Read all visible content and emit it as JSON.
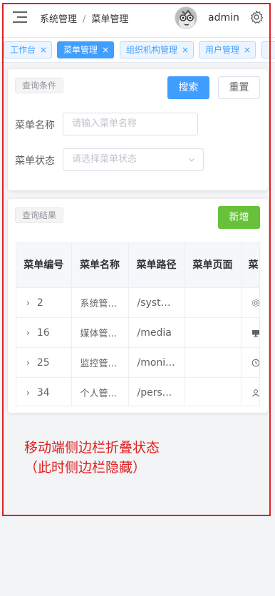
{
  "header": {
    "breadcrumb": [
      "系统管理",
      "菜单管理"
    ],
    "breadcrumb_separator": "/",
    "username": "admin"
  },
  "tags": [
    {
      "label": "工作台",
      "active": false
    },
    {
      "label": "菜单管理",
      "active": true
    },
    {
      "label": "组织机构管理",
      "active": false
    },
    {
      "label": "用户管理",
      "active": false
    }
  ],
  "tag_close": "×",
  "query": {
    "section_label": "查询条件",
    "search_button": "搜索",
    "reset_button": "重置",
    "name_label": "菜单名称",
    "name_placeholder": "请输入菜单名称",
    "status_label": "菜单状态",
    "status_placeholder": "请选择菜单状态"
  },
  "results": {
    "section_label": "查询结果",
    "add_button": "新增",
    "columns": [
      "菜单编号",
      "菜单名称",
      "菜单路径",
      "菜单页面",
      "菜"
    ],
    "rows": [
      {
        "id": "2",
        "name": "系统管...",
        "path": "/system",
        "page": "",
        "icon": "gear-icon"
      },
      {
        "id": "16",
        "name": "媒体管...",
        "path": "/media",
        "page": "",
        "icon": "monitor-icon"
      },
      {
        "id": "25",
        "name": "监控管...",
        "path": "/moni...",
        "page": "",
        "icon": "clock-icon"
      },
      {
        "id": "34",
        "name": "个人管...",
        "path": "/pers...",
        "page": "",
        "icon": "user-icon"
      }
    ]
  },
  "annotation": {
    "line1": "移动端侧边栏折叠状态",
    "line2": "（此时侧边栏隐藏）"
  },
  "colors": {
    "primary": "#409eff",
    "success": "#67c23a",
    "annotation_red": "#e02020"
  }
}
